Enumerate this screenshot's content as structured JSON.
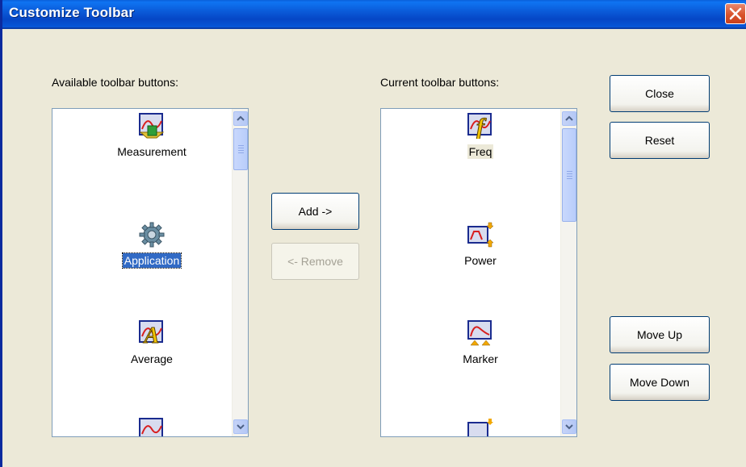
{
  "window": {
    "title": "Customize Toolbar"
  },
  "available": {
    "label": "Available toolbar buttons:",
    "items": [
      {
        "label": "Measurement",
        "icon": "measurement-icon"
      },
      {
        "label": "Application",
        "icon": "gear-icon",
        "selected": true
      },
      {
        "label": "Average",
        "icon": "average-icon"
      }
    ]
  },
  "current": {
    "label": "Current toolbar buttons:",
    "items": [
      {
        "label": "Freq",
        "icon": "freq-icon"
      },
      {
        "label": "Power",
        "icon": "power-icon"
      },
      {
        "label": "Marker",
        "icon": "marker-icon"
      }
    ]
  },
  "buttons": {
    "add": "Add ->",
    "remove": "<- Remove",
    "close": "Close",
    "reset": "Reset",
    "move_up": "Move Up",
    "move_down": "Move Down"
  },
  "colors": {
    "selection": "#316ac5",
    "titlebar": "#0a58d6",
    "dialog": "#ece9d8"
  }
}
